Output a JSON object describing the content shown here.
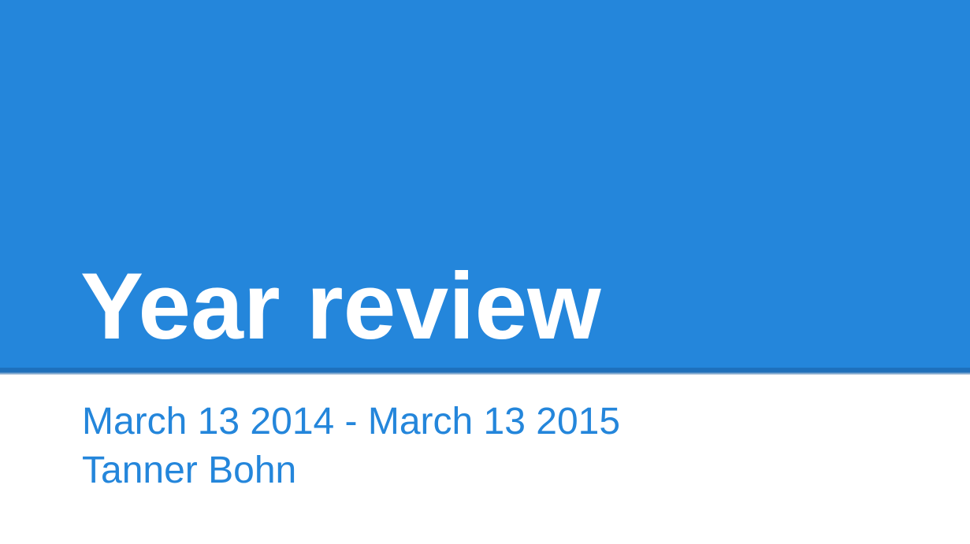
{
  "slide": {
    "title": "Year review",
    "date_range": "March 13 2014 - March 13 2015",
    "author": "Tanner Bohn"
  },
  "colors": {
    "banner": "#2486db",
    "title_text": "#ffffff",
    "subtitle_text": "#2486db",
    "background": "#ffffff"
  }
}
